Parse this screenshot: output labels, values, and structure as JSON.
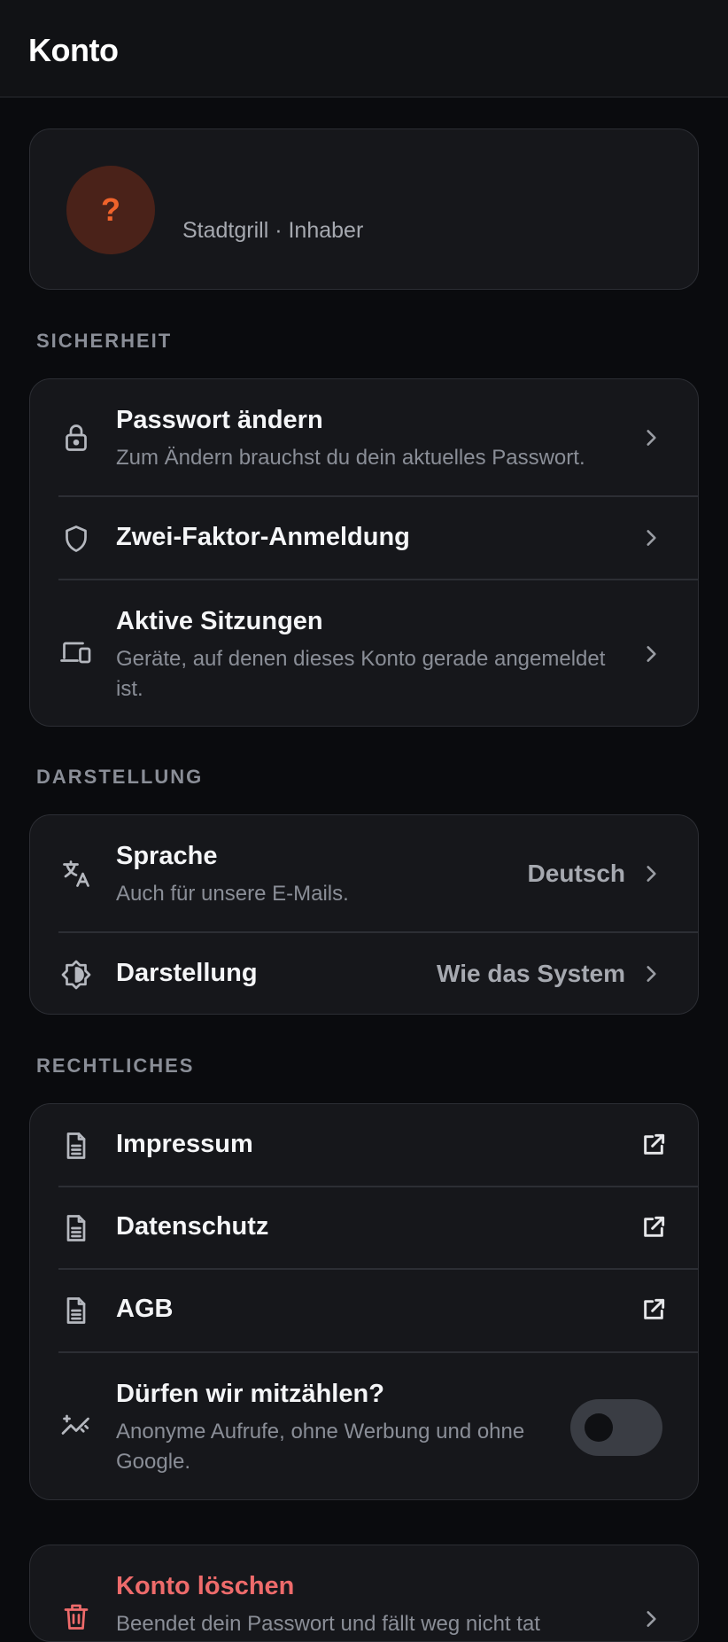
{
  "header": {
    "title": "Konto"
  },
  "profile": {
    "avatar_glyph": "?",
    "subtitle": "Stadtgrill · Inhaber"
  },
  "sections": {
    "security": {
      "label": "SICHERHEIT",
      "items": [
        {
          "title": "Passwort ändern",
          "subtitle": "Zum Ändern brauchst du dein aktuelles Passwort.",
          "icon": "lock-icon"
        },
        {
          "title": "Zwei-Faktor-Anmeldung",
          "icon": "shield-icon"
        },
        {
          "title": "Aktive Sitzungen",
          "subtitle_line1": "Geräte, auf denen dieses Konto gerade angemeldet",
          "subtitle_line2": "ist.",
          "icon": "devices-icon"
        }
      ]
    },
    "appearance": {
      "label": "DARSTELLUNG",
      "items": [
        {
          "title": "Sprache",
          "subtitle": "Auch für unsere E-Mails.",
          "value": "Deutsch",
          "icon": "translate-icon"
        },
        {
          "title": "Darstellung",
          "value": "Wie das System",
          "icon": "brightness-icon"
        }
      ]
    },
    "legal": {
      "label": "RECHTLICHES",
      "items": [
        {
          "title": "Impressum",
          "icon": "document-icon"
        },
        {
          "title": "Datenschutz",
          "icon": "document-icon"
        },
        {
          "title": "AGB",
          "icon": "document-icon"
        },
        {
          "title": "Dürfen wir mitzählen?",
          "subtitle_line1": "Anonyme Aufrufe, ohne Werbung und ohne",
          "subtitle_line2": "Google.",
          "icon": "analytics-icon",
          "toggle_on": false
        }
      ]
    },
    "danger": {
      "title": "Konto löschen",
      "subtitle": "Beendet dein Passwort und fällt weg nicht tat",
      "icon": "trash-icon"
    }
  },
  "colors": {
    "background": "#0a0b0e",
    "card": "#16171b",
    "accent_orange": "#f0632b",
    "danger_red": "#ee6b6b"
  }
}
